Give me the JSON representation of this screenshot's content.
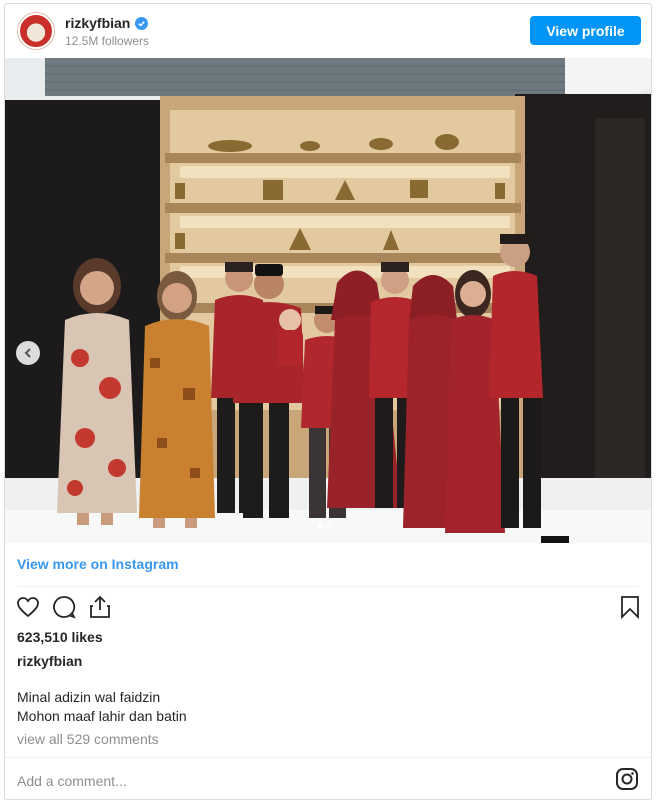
{
  "header": {
    "username": "rizkyfbian",
    "followers": "12.5M followers",
    "view_profile_label": "View profile"
  },
  "carousel": {
    "slide_count": 2,
    "active_slide": 1
  },
  "link": {
    "view_more_label": "View more on Instagram"
  },
  "post": {
    "likes": "623,510 likes",
    "poster": "rizkyfbian",
    "caption_lines": [
      "Minal adizin wal faidzin",
      "Mohon maaf lahir dan batin"
    ],
    "comments_label": "view all 529 comments",
    "add_comment_placeholder": "Add a comment..."
  },
  "icons": {
    "like": "heart-icon",
    "comment": "comment-icon",
    "share": "share-icon",
    "save": "bookmark-icon",
    "instagram": "instagram-logo-icon",
    "verified": "verified-badge-icon",
    "carousel_prev": "chevron-left-icon"
  },
  "colors": {
    "accent": "#0095f6",
    "link": "#3897f0",
    "muted": "#8e8e8e",
    "outfit_red": "#a8262b"
  }
}
